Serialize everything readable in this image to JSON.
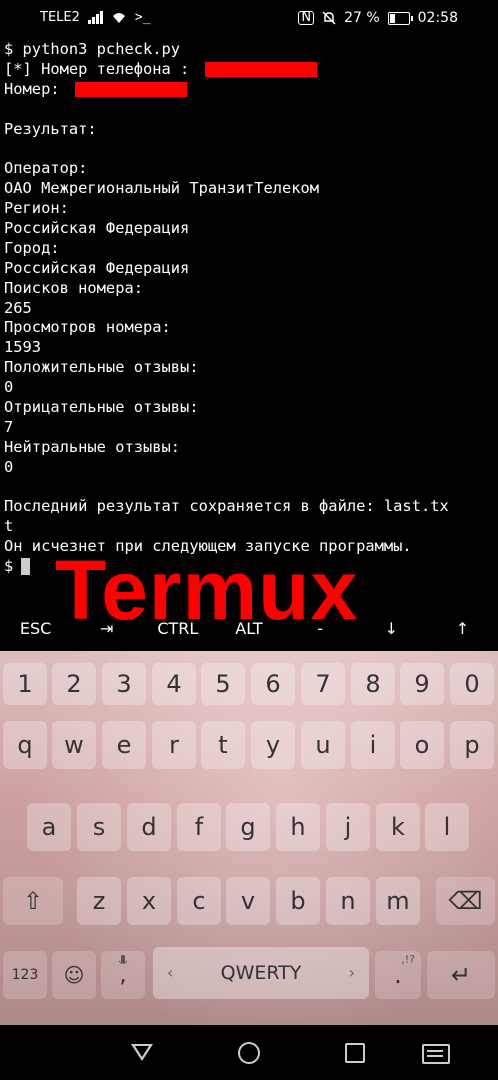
{
  "status_bar": {
    "carrier": "TELE2",
    "battery": "27 %",
    "time": "02:58",
    "icons": [
      "signal-icon",
      "wifi-icon",
      "terminal-icon",
      "nfc-icon",
      "mute-icon",
      "battery-icon"
    ]
  },
  "terminal": {
    "lines": [
      "$ python3 pcheck.py",
      "[*] Номер телефона : ",
      "Номер: ",
      "",
      "Результат:",
      "",
      "Оператор:",
      "ОАО Межрегиональный ТранзитТелеком",
      "Регион:",
      "Российская Федерация",
      "Город:",
      "Российская Федерация",
      "Поисков номера:",
      "265",
      "Просмотров номера:",
      "1593",
      "Положительные отзывы:",
      "0",
      "Отрицательные отзывы:",
      "7",
      "Нейтральные отзывы:",
      "0",
      "",
      "Последний результат сохраняется в файле: last.tx",
      "t",
      "Он исчезнет при следующем запуске программы.",
      "$"
    ],
    "redaction_color": "#ff0000"
  },
  "overlay_text": "Termux",
  "extra_keys": [
    "ESC",
    "⇥",
    "CTRL",
    "ALT",
    "-",
    "↓",
    "↑"
  ],
  "keyboard": {
    "row_numbers": [
      "1",
      "2",
      "3",
      "4",
      "5",
      "6",
      "7",
      "8",
      "9",
      "0"
    ],
    "row1": [
      "q",
      "w",
      "e",
      "r",
      "t",
      "y",
      "u",
      "i",
      "o",
      "p"
    ],
    "row2": [
      "a",
      "s",
      "d",
      "f",
      "g",
      "h",
      "j",
      "k",
      "l"
    ],
    "row3": [
      "z",
      "x",
      "c",
      "v",
      "b",
      "n",
      "m"
    ],
    "shift": "⇧",
    "backspace": "⌫",
    "mode_key": "123",
    "emoji": "☺",
    "comma": ",",
    "space_label": "QWERTY",
    "punct": ".",
    "punct_hint": ",!?",
    "enter": "↵"
  }
}
